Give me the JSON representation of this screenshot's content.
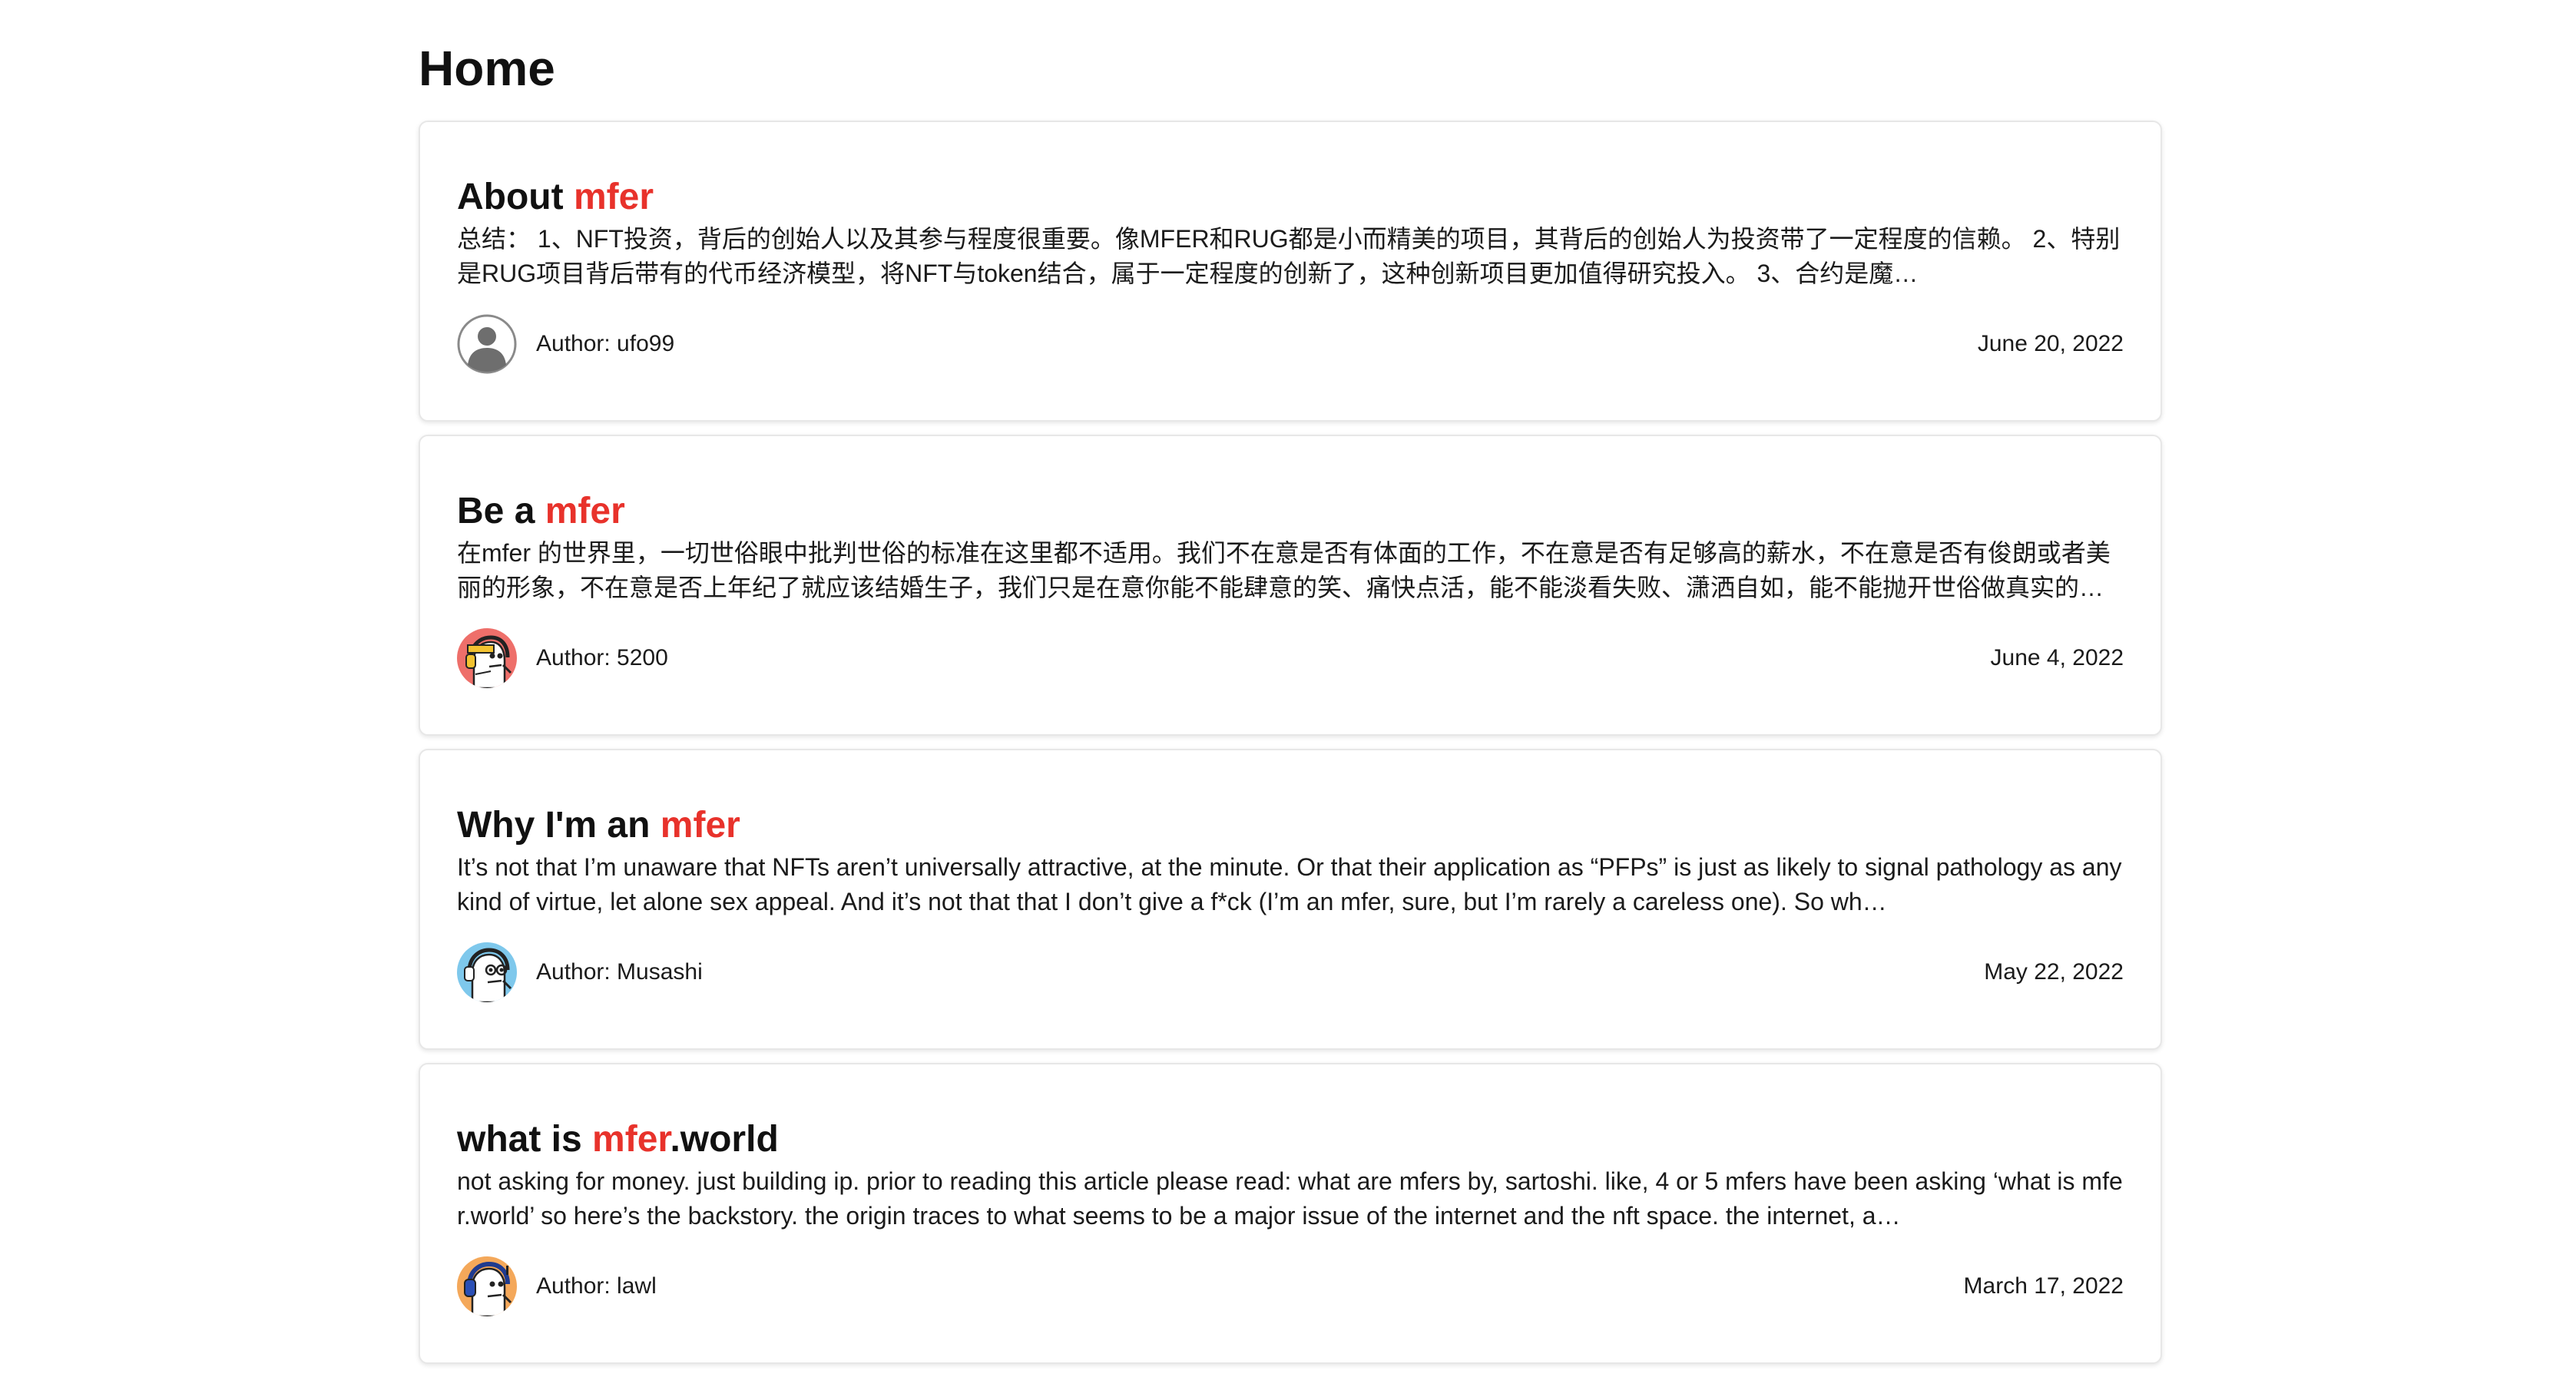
{
  "page": {
    "title": "Home"
  },
  "colors": {
    "accent": "#e8322b",
    "text": "#111111",
    "card_border": "#e7e7e7"
  },
  "posts": [
    {
      "title_prefix": "About ",
      "title_accent": "mfer",
      "title_suffix": "",
      "excerpt": "总结： 1、NFT投资，背后的创始人以及其参与程度很重要。像MFER和RUG都是小而精美的项目，其背后的创始人为投资带了一定程度的信赖。 2、特别是RUG项目背后带有的代币经济模型，将NFT与token结合，属于一定程度的创新了，这种创新项目更加值得研究投入。 3、合约是魔…",
      "author": "Author: ufo99",
      "date": "June 20, 2022",
      "avatar_icon": "default-user-avatar-icon"
    },
    {
      "title_prefix": "Be a ",
      "title_accent": "mfer",
      "title_suffix": "",
      "excerpt": "在mfer 的世界里，一切世俗眼中批判世俗的标准在这里都不适用。我们不在意是否有体面的工作，不在意是否有足够高的薪水，不在意是否有俊朗或者美丽的形象，不在意是否上年纪了就应该结婚生子，我们只是在意你能不能肆意的笑、痛快点活，能不能淡看失败、潇洒自如，能不能抛开世俗做真实的…",
      "author": "Author: 5200",
      "date": "June 4, 2022",
      "avatar_icon": "mfer-avatar-red-icon"
    },
    {
      "title_prefix": "Why I'm an ",
      "title_accent": "mfer",
      "title_suffix": "",
      "excerpt": "It’s not that I’m unaware that NFTs aren’t universally attractive, at the minute. Or that their application as “PFPs” is just as likely to signal pathology as any kind of virtue, let alone sex appeal. And it’s not that that I don’t give a f*ck (I’m an mfer, sure, but I’m rarely a careless one). So wh…",
      "author": "Author: Musashi",
      "date": "May 22, 2022",
      "avatar_icon": "mfer-avatar-blue-icon"
    },
    {
      "title_prefix": "what is ",
      "title_accent": "mfer",
      "title_suffix": ".world",
      "excerpt": "not asking for money. just building ip. prior to reading this article please read: what are mfers by, sartoshi. like, 4 or 5 mfers have been asking ‘what is mfer.world’ so here’s the backstory. the origin traces to what seems to be a major issue of the internet and the nft space. the internet, a…",
      "author": "Author: lawl",
      "date": "March 17, 2022",
      "avatar_icon": "mfer-avatar-orange-icon"
    }
  ]
}
